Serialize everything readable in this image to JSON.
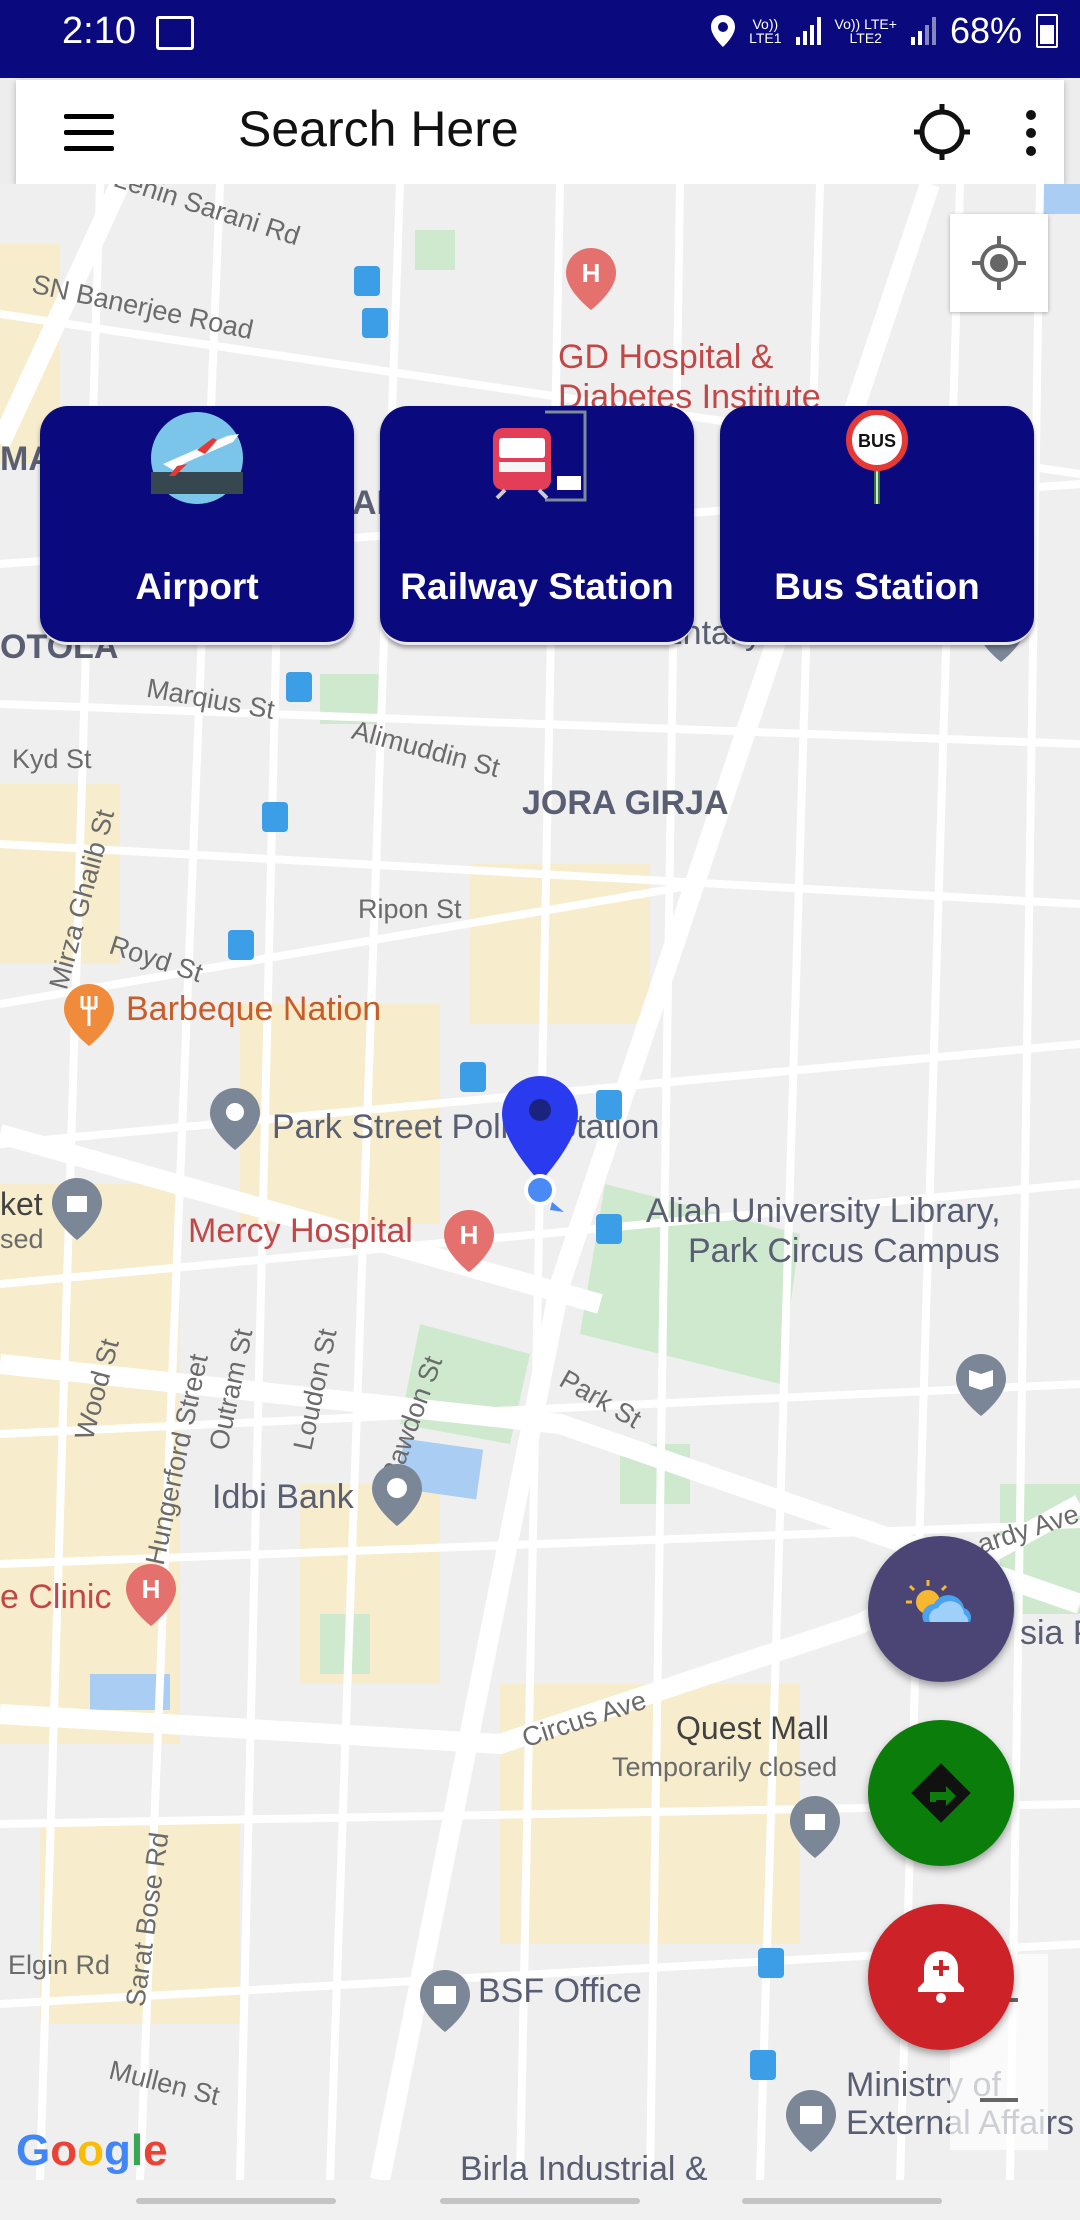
{
  "status_bar": {
    "time": "2:10",
    "net_1": "Vo))\nLTE1",
    "net_2": "Vo)) LTE+\nLTE2",
    "battery": "68%"
  },
  "search": {
    "placeholder": "Search Here"
  },
  "categories": [
    {
      "label": "Airport",
      "icon": "airplane-icon"
    },
    {
      "label": "Railway Station",
      "icon": "train-icon"
    },
    {
      "label": "Bus Station",
      "icon": "bus-stop-icon",
      "badge": "BUS"
    }
  ],
  "map": {
    "labels": {
      "lenin_sarani": "Lenin Sarani Rd",
      "sn_banerjee": "SN Banerjee Road",
      "gd_hospital_1": "GD Hospital &",
      "gd_hospital_2": "Diabetes Institute",
      "tola": "OTOLA",
      "entally": "Entally Post Office",
      "marquis": "Marqius St",
      "kyd": "Kyd St",
      "alimuddin": "Alimuddin St",
      "jora_girja": "JORA GIRJA",
      "mirza": "Mirza Ghalib St",
      "ripon": "Ripon St",
      "royd": "Royd St",
      "barbeque": "Barbeque Nation",
      "park_police": "Park Street Police Station",
      "ket": "ket",
      "sed": "sed",
      "aliah_1": "Aliah University Library,",
      "aliah_2": "Park Circus Campus",
      "mercy": "Mercy Hospital",
      "wood": "Wood St",
      "hungerford": "Hungerford Street",
      "outram": "Outram St",
      "loudon": "Loudon St",
      "rawdon": "Rawdon St",
      "park_st": "Park St",
      "idbi": "Idbi Bank",
      "clinic": "e Clinic",
      "circus": "Circus Ave",
      "quest": "Quest Mall",
      "temp_closed": "Temporarily closed",
      "sarat": "Sarat Bose Rd",
      "elgin": "Elgin Rd",
      "bsf": "BSF Office",
      "mullen": "Mullen St",
      "ministry_1": "Ministry of",
      "ministry_2": "External Affairs",
      "birla": "Birla Industrial &",
      "hardy": "ardy Ave",
      "sia": "sia Po",
      "mat": "MAT",
      "an": "AN"
    },
    "attribution": "Google"
  },
  "colors": {
    "primary": "#0a0a7e",
    "weather_fab": "#4b4576",
    "route_fab": "#0a7d0a",
    "sos_fab": "#cc2228",
    "marker": "#2a3bef"
  }
}
